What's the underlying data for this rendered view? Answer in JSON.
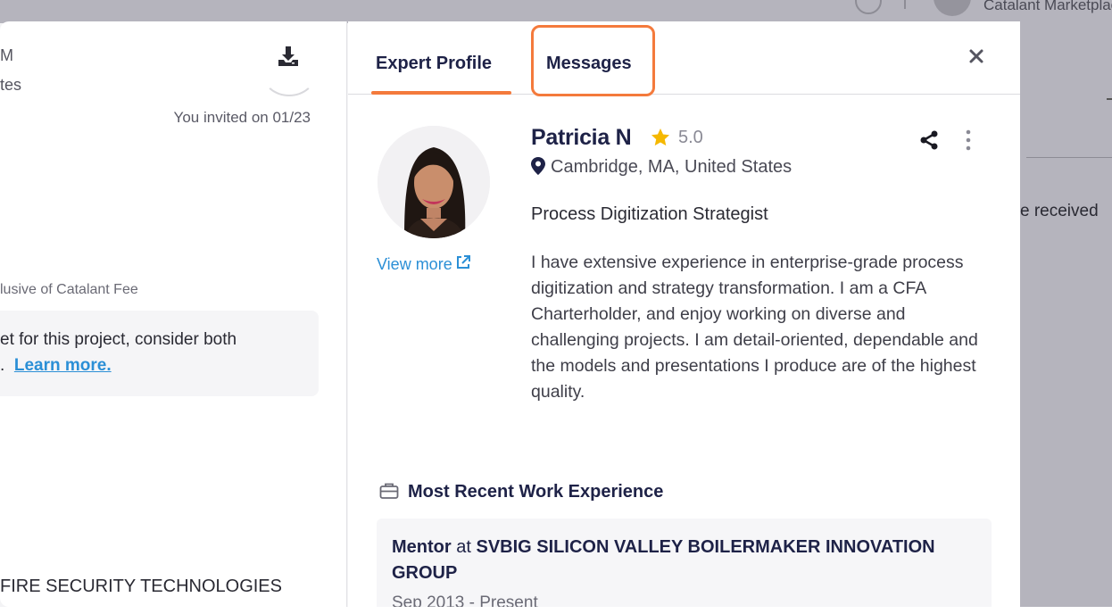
{
  "backdrop": {
    "company_label": "Catalant Marketplace",
    "right_text": "e received"
  },
  "left_panel": {
    "fragment_m": "M",
    "fragment_tes": "tes",
    "invited": "You invited on 01/23",
    "fee_note": "lusive of Catalant Fee",
    "tip_line1": "et for this project, consider both",
    "tip_line2_prefix": ".",
    "learn_more": "Learn more.",
    "company_fragment": "FIRE SECURITY TECHNOLOGIES"
  },
  "tabs": [
    {
      "label": "Expert Profile",
      "active": true
    },
    {
      "label": "Messages",
      "active": false,
      "highlighted": true
    }
  ],
  "profile": {
    "name": "Patricia N",
    "rating": "5.0",
    "location": "Cambridge, MA, United States",
    "title": "Process Digitization Strategist",
    "view_more": "View more",
    "bio": "I have extensive experience in enterprise-grade process digitization and strategy transformation. I am a CFA Charterholder, and enjoy working on diverse and challenging projects. I am detail-oriented, dependable and the models and presentations I produce are of the highest quality."
  },
  "experience": {
    "heading": "Most Recent Work Experience",
    "role": "Mentor",
    "at": "at",
    "organization": "SVBIG SILICON VALLEY BOILERMAKER INNOVATION GROUP",
    "dates": "Sep 2013 - Present"
  },
  "colors": {
    "accent": "#f47a3c",
    "navy": "#1e2247",
    "link": "#2b8fd6",
    "star": "#f5b800"
  },
  "icons": {
    "download": "download-icon",
    "close": "close-icon",
    "star": "star-icon",
    "share": "share-icon",
    "more": "more-vertical-icon",
    "location": "map-pin-icon",
    "external": "external-link-icon",
    "briefcase": "briefcase-icon"
  }
}
